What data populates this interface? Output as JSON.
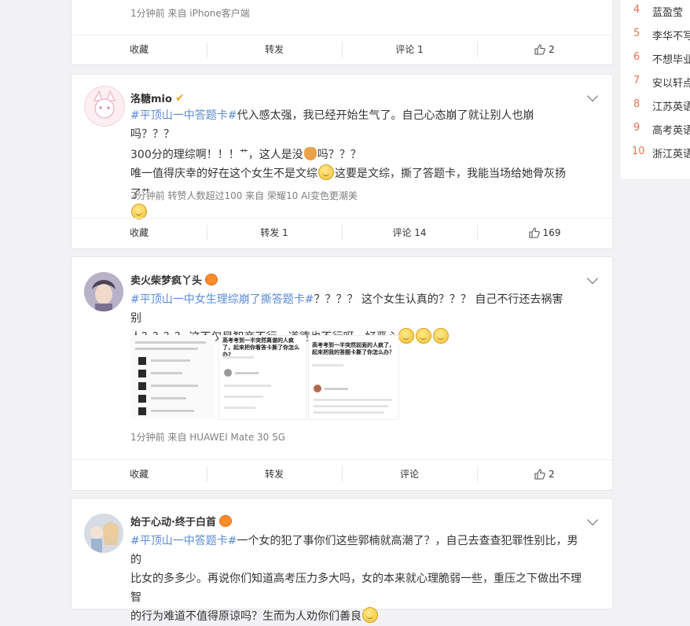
{
  "sidebar": {
    "items": [
      {
        "rank": "4",
        "title": "蓝盈莹"
      },
      {
        "rank": "5",
        "title": "李华不写"
      },
      {
        "rank": "6",
        "title": "不想毕业"
      },
      {
        "rank": "7",
        "title": "安以轩点"
      },
      {
        "rank": "8",
        "title": "江苏英语"
      },
      {
        "rank": "9",
        "title": "高考英语"
      },
      {
        "rank": "10",
        "title": "浙江英语"
      }
    ]
  },
  "post0": {
    "meta": "1分钟前  来自 iPhone客户端",
    "actions": {
      "collect": "收藏",
      "repost": "转发",
      "comment": "评论 1",
      "like": "2"
    }
  },
  "post1": {
    "user": "洛糖mio",
    "tag": "#平顶山一中答题卡#",
    "line1": "代入感太强，我已经开始生气了。自己心态崩了就让别人也崩吗？？？",
    "line2a": "300分的理综啊！！！",
    "lol1": "艹",
    "line2b": "，这人是没",
    "line2c": "吗？？？",
    "line3a": "唯一值得庆幸的好在这个女生不是文综",
    "line3b": "这要是文综，撕了答题卡，我能当场给她骨灰扬了",
    "lol2": "艹",
    "meta": "2分钟前  转赞人数超过100  来自 荣耀10 AI变色更潮美",
    "actions": {
      "collect": "收藏",
      "repost": "转发 1",
      "comment": "评论 14",
      "like": "169"
    }
  },
  "post2": {
    "user": "卖火柴梦疯丫头",
    "tag1": "#平顶山一中",
    "tag2": "女生理综崩了撕答题卡#",
    "line1": "？？？？ 这个女生认真的？？？ 自己不行还去祸害别",
    "line2": "人？？？？ 这不仅是智商不行，道德也不行呀，好恶心",
    "img2_title": "高考考到一半突然离谱的人疯了，起来把你看答卡撕了你怎么办?",
    "img3_title": "高考考到一半突然前面的人疯了，起来把我的答题卡撕了你怎么办？",
    "meta": "1分钟前  来自 HUAWEI Mate 30 5G",
    "actions": {
      "collect": "收藏",
      "repost": "转发",
      "comment": "评论",
      "like": "2"
    }
  },
  "post3": {
    "user": "始于心动·终于白首",
    "tag": "#平顶山一中答题卡#",
    "line1": "一个女的犯了事你们这些郭楠就高潮了？，自己去查查犯罪性别比，男的",
    "line2": "比女的多多少。再说你们知道高考压力多大吗，女的本来就心理脆弱一些，重压之下做出不理智",
    "line3": "的行为难道不值得原谅吗？生而为人劝你们善良"
  },
  "colors": {
    "accent": "#eb7350",
    "tag_blue": "#5b8bd6",
    "meta": "#808080"
  }
}
